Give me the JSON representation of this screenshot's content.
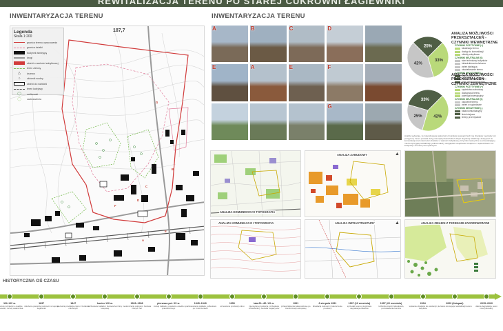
{
  "header": {
    "title": "REWITALIZACJA TERENU PO STAREJ CUKROWNI ŁAGIEWNIKI"
  },
  "left": {
    "title": "INWENTARYZACJA TERENU",
    "legend": {
      "title": "Legenda",
      "scale": "Skala 1:200",
      "items": [
        {
          "label": "granica terenu opracowania",
          "type": "line-red"
        },
        {
          "label": "granica działki",
          "type": "line-pink"
        },
        {
          "label": "budynek istniejący",
          "type": "box-black"
        },
        {
          "label": "drogi",
          "type": "line-gray"
        },
        {
          "label": "obiekt o wartości zabytkowej",
          "type": "box-red"
        },
        {
          "label": "teren zielony",
          "type": "line-green"
        },
        {
          "label": "drzewa",
          "type": "triangle"
        },
        {
          "label": "zbiornik wodny",
          "type": "circle"
        },
        {
          "label": "obiekt do rozbiórki",
          "type": "box-outline"
        },
        {
          "label": "teren kolejowy",
          "type": "dash"
        },
        {
          "label": "roślinność",
          "type": "circle-green"
        },
        {
          "label": "zadrzewienia",
          "type": "circle-light"
        }
      ]
    },
    "map_number": "187,7",
    "map_letters": [
      "G",
      "B",
      "C",
      "D",
      "F",
      "A",
      "E"
    ]
  },
  "middle": {
    "title": "INWENTARYZACJA TERENU",
    "photos": [
      {
        "letter": "A",
        "c1": "#a7b7c8",
        "c2": "#7a6a58"
      },
      {
        "letter": "B",
        "c1": "#9fb0c0",
        "c2": "#6b5a45"
      },
      {
        "letter": "C",
        "c1": "#b0bcc6",
        "c2": "#7d6a58"
      },
      {
        "letter": "D",
        "c1": "#c5ced6",
        "c2": "#8a6e5a"
      },
      {
        "letter": "",
        "c1": "#9aa8b4",
        "c2": "#6b6a50"
      },
      {
        "letter": "E",
        "c1": "#a0b4c8",
        "c2": "#5f5040"
      },
      {
        "letter": "A",
        "c1": "#b4c1cc",
        "c2": "#8a5a3c"
      },
      {
        "letter": "E",
        "c1": "#aab8c4",
        "c2": "#6e6050"
      },
      {
        "letter": "F",
        "c1": "#c0cad2",
        "c2": "#8c7a66"
      },
      {
        "letter": "",
        "c1": "#a5aeb8",
        "c2": "#7a4a30"
      },
      {
        "letter": "",
        "c1": "#c4d2de",
        "c2": "#6f8a5a"
      },
      {
        "letter": "",
        "c1": "#b8c6d2",
        "c2": "#6a7a58"
      },
      {
        "letter": "",
        "c1": "#b4c2ce",
        "c2": "#7a806a"
      },
      {
        "letter": "G",
        "c1": "#a8b8c8",
        "c2": "#5a6a4a"
      },
      {
        "letter": "",
        "c1": "#9ca8b0",
        "c2": "#5e5a48"
      }
    ],
    "maps": {
      "zabudowa": "ANALIZA ZABUDOWY",
      "komunikacja": "ANALIZA KOMUNIKACJI I TOPOGRAFIA",
      "infrastruktura": "ANALIZA INFRASTRUKTURY"
    }
  },
  "right": {
    "internal": {
      "title": "ANALIZA MOŻLIWOŚCI PRZEKSZTAŁCEŃ - CZYNNIKI WEWNĘTRZNE",
      "segments": [
        {
          "label": "33%",
          "value": 33,
          "color": "#b9d97a"
        },
        {
          "label": "42%",
          "value": 42,
          "color": "#c6c6c6"
        },
        {
          "label": "25%",
          "value": 25,
          "color": "#4f5e45"
        }
      ],
      "legend": [
        {
          "text": "CZYNNIKI POZYTYWNE (+)",
          "hdr": true
        },
        {
          "text": "lokalizacja terenu",
          "color": "#b9d97a"
        },
        {
          "text": "dostęp do komunikacji",
          "color": "#b9d97a"
        },
        {
          "text": "obiekty zabytkowe",
          "color": "#b9d97a"
        },
        {
          "text": "CZYNNIKI NEUTRALNE (0)",
          "hdr": true
        },
        {
          "text": "stan techniczny budynków",
          "color": "#c6c6c6"
        },
        {
          "text": "infrastruktura techniczna",
          "color": "#c6c6c6"
        },
        {
          "text": "zieleń istniejąca",
          "color": "#c6c6c6"
        },
        {
          "text": "ukształtowanie terenu",
          "color": "#c6c6c6"
        },
        {
          "text": "CZYNNIKI NEGATYWNE (-)",
          "hdr": true
        },
        {
          "text": "degradacja terenu",
          "color": "#4f5e45"
        },
        {
          "text": "zanieczyszczenie gleby",
          "color": "#4f5e45"
        },
        {
          "text": "brak zagospodarowania",
          "color": "#4f5e45"
        }
      ]
    },
    "external": {
      "title": "ANALIZA MOŻLIWOŚCI PRZEKSZTAŁCEŃ - CZYNNIKI ZEWNĘTRZNE",
      "segments": [
        {
          "label": "42%",
          "value": 42,
          "color": "#b9d97a"
        },
        {
          "label": "25%",
          "value": 25,
          "color": "#c6c6c6"
        },
        {
          "label": "33%",
          "value": 33,
          "color": "#4f5e45"
        }
      ],
      "legend": [
        {
          "text": "CZYNNIKI POZYTYWNE (+)",
          "hdr": true
        },
        {
          "text": "sąsiedztwo zabudowy",
          "color": "#b9d97a"
        },
        {
          "text": "dostępność terenu",
          "color": "#b9d97a"
        },
        {
          "text": "potencjał inwestycyjny",
          "color": "#b9d97a"
        },
        {
          "text": "CZYNNIKI NEUTRALNE (0)",
          "hdr": true
        },
        {
          "text": "otoczenie terenu",
          "color": "#c6c6c6"
        },
        {
          "text": "zieleń w sąsiedztwie",
          "color": "#c6c6c6"
        },
        {
          "text": "CZYNNIKI NEGATYWNE (-)",
          "hdr": true
        },
        {
          "text": "hałas komunikacyjny",
          "color": "#4f5e45"
        },
        {
          "text": "linia kolejowa",
          "color": "#4f5e45"
        },
        {
          "text": "tereny przemysłowe",
          "color": "#4f5e45"
        }
      ]
    },
    "paragraph": "Analiza wykazuje, że zdecydowana większość czynników wewnętrznych ma charakter neutralny lub pozytywny. Teren posiada duży potencjał przekształceń dzięki dogodnej lokalizacji, dostępowi do komunikacji oraz obecności obiektów o wartości zabytkowej. Czynniki zewnętrzne w przeważającej mierze sprzyjają rewitalizacji, jednak należy uwzględnić uciążliwości związane z sąsiedztwem linii kolejowej i terenów przemysłowych.",
    "green_map_label": "ANALIZA ZIELENI Z TERENAMI ZADRZEWIONYMI"
  },
  "timeline": {
    "title": "HISTORYCZNA OŚ CZASU",
    "events": [
      {
        "date": "XIII–XIV w.",
        "text": "pierwsze wzmianki o osadzie Łagiewniki, rozwój osadnictwa"
      },
      {
        "date": "1837",
        "text": "założenie pierwszej cukrowni w rejonie Łagiewnik"
      },
      {
        "date": "1847",
        "text": "pierwsza produkcja cukru z buraków cukrowych"
      },
      {
        "date": "koniec XIX w.",
        "text": "rozbudowa zakładu i budowa bocznicy kolejowej"
      },
      {
        "date": "1903–1908",
        "text": "modernizacja cukrowni, budowa nowych hal"
      },
      {
        "date": "pierwsza poł. XX w.",
        "text": "rozwój zakładu, powstanie osiedla pracowniczego"
      },
      {
        "date": "1945–1949",
        "text": "upaństwowienie zakładu, odbudowa po zniszczeniach"
      },
      {
        "date": "1950",
        "text": "wznowienie produkcji cukru"
      },
      {
        "date": "lata 60.–80. XX w.",
        "text": "intensywna produkcja, rozbudowa infrastruktury, budowa magazynów"
      },
      {
        "date": "1991",
        "text": "przekształcenia własnościowe po transformacji ustrojowej"
      },
      {
        "date": "6 sierpnia 1991",
        "text": "likwidacja cukrowni i zakończenie produkcji"
      },
      {
        "date": "1997 (10 września)",
        "text": "sprzedaż terenu, stopniowa degradacja obiektów"
      },
      {
        "date": "1997 (22 września)",
        "text": "rozbiórka części zabudowań, pozostawienie komina"
      },
      {
        "date": "2004",
        "text": "wpisanie obiektów do ewidencji zabytków"
      },
      {
        "date": "2009 (listopad)",
        "text": "pierwsze koncepcje rewitalizacji terenu"
      },
      {
        "date": "2015–2020",
        "text": "dalsza degradacja, teren nieużytkowany"
      }
    ]
  }
}
